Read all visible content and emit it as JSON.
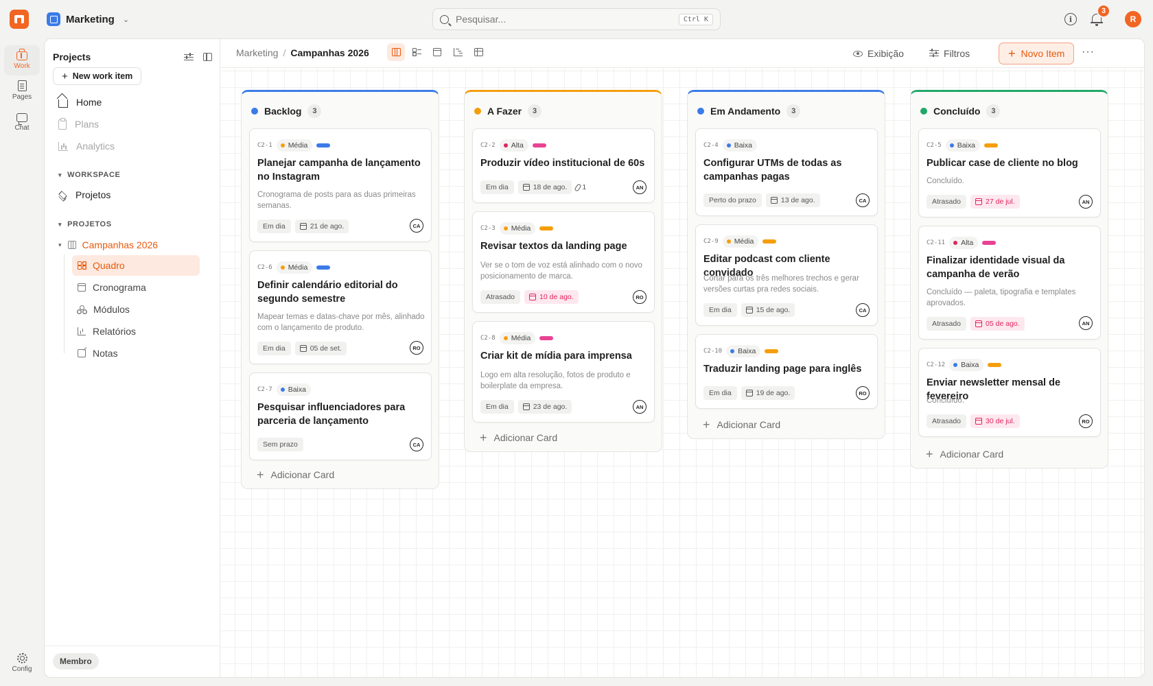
{
  "topbar": {
    "workspace_name": "Marketing",
    "search_placeholder": "Pesquisar...",
    "search_shortcut": "Ctrl K",
    "notification_count": "3",
    "user_initial": "R"
  },
  "rail": {
    "items": [
      {
        "label": "Work",
        "icon": "briefcase-icon",
        "active": true
      },
      {
        "label": "Pages",
        "icon": "page-icon"
      },
      {
        "label": "Chat",
        "icon": "chat-icon"
      }
    ],
    "config_label": "Config"
  },
  "sidebar": {
    "title": "Projects",
    "new_work_item": "New work item",
    "nav": [
      {
        "label": "Home",
        "icon": "home-icon"
      },
      {
        "label": "Plans",
        "icon": "clipboard-icon",
        "disabled": true
      },
      {
        "label": "Analytics",
        "icon": "bar-chart-icon",
        "disabled": true
      }
    ],
    "workspace_section": "WORKSPACE",
    "workspace_items": [
      {
        "label": "Projetos",
        "icon": "layers-icon"
      }
    ],
    "projects_section": "PROJETOS",
    "project_name": "Campanhas 2026",
    "project_items": [
      {
        "label": "Quadro",
        "icon": "board-icon",
        "active": true
      },
      {
        "label": "Cronograma",
        "icon": "calendar-icon"
      },
      {
        "label": "Módulos",
        "icon": "modules-icon"
      },
      {
        "label": "Relatórios",
        "icon": "reports-icon"
      },
      {
        "label": "Notas",
        "icon": "notes-icon"
      }
    ],
    "role": "Membro"
  },
  "header": {
    "breadcrumb_root": "Marketing",
    "breadcrumb_current": "Campanhas 2026",
    "views": [
      "board",
      "list",
      "calendar",
      "gantt",
      "spreadsheet"
    ],
    "display_label": "Exibição",
    "filters_label": "Filtros",
    "new_item_label": "Novo Item"
  },
  "colors": {
    "accent": "#f26522",
    "backlog": "#3b7be8",
    "todo": "#f59e0b",
    "in_progress": "#3b7be8",
    "done": "#22a86a",
    "priority_alta": "#e0245e",
    "priority_media": "#f59e0b",
    "priority_baixa": "#3b7be8"
  },
  "add_card_label": "Adicionar Card",
  "columns": [
    {
      "title": "Backlog",
      "count": "3",
      "color": "#3b7be8",
      "cards": [
        {
          "id": "C2-1",
          "priority": "Média",
          "title": "Planejar campanha de lançamento no Instagram",
          "desc": "Cronograma de posts para as duas primeiras semanas.",
          "status": "Em dia",
          "date": "21 de ago.",
          "assignee": "CA"
        },
        {
          "id": "C2-6",
          "priority": "Média",
          "title": "Definir calendário editorial do segundo semestre",
          "desc": "Mapear temas e datas-chave por mês, alinhado com o lançamento de produto.",
          "status": "Em dia",
          "date": "05 de set.",
          "assignee": "RO"
        },
        {
          "id": "C2-7",
          "priority": "Baixa",
          "title": "Pesquisar influenciadores para parceria de lançamento",
          "status": "Sem prazo",
          "assignee": "CA"
        }
      ]
    },
    {
      "title": "A Fazer",
      "count": "3",
      "color": "#f59e0b",
      "cards": [
        {
          "id": "C2-2",
          "priority": "Alta",
          "title": "Produzir vídeo institucional de 60s",
          "status": "Em dia",
          "date": "18 de ago.",
          "attachments": "1",
          "assignee": "AN"
        },
        {
          "id": "C2-3",
          "priority": "Média",
          "title": "Revisar textos da landing page",
          "desc": "Ver se o tom de voz está alinhado com o novo posicionamento de marca.",
          "status": "Atrasado",
          "date": "10 de ago.",
          "assignee": "RO"
        },
        {
          "id": "C2-8",
          "priority": "Média",
          "title": "Criar kit de mídia para imprensa",
          "desc": "Logo em alta resolução, fotos de produto e boilerplate da empresa.",
          "status": "Em dia",
          "date": "23 de ago.",
          "assignee": "AN"
        }
      ]
    },
    {
      "title": "Em Andamento",
      "count": "3",
      "color": "#3b7be8",
      "cards": [
        {
          "id": "C2-4",
          "priority": "Baixa",
          "title": "Configurar UTMs de todas as campanhas pagas",
          "status": "Perto do prazo",
          "date": "13 de ago.",
          "assignee": "CA"
        },
        {
          "id": "C2-9",
          "priority": "Média",
          "title": "Editar podcast com cliente convidado",
          "desc": "Cortar para os três melhores trechos e gerar versões curtas pra redes sociais.",
          "status": "Em dia",
          "date": "15 de ago.",
          "assignee": "CA"
        },
        {
          "id": "C2-10",
          "priority": "Baixa",
          "title": "Traduzir landing page para inglês",
          "status": "Em dia",
          "date": "19 de ago.",
          "assignee": "RO"
        }
      ]
    },
    {
      "title": "Concluído",
      "count": "3",
      "color": "#22a86a",
      "cards": [
        {
          "id": "C2-5",
          "priority": "Baixa",
          "title": "Publicar case de cliente no blog",
          "desc": "Concluído.",
          "status": "Atrasado",
          "date": "27 de jul.",
          "assignee": "AN"
        },
        {
          "id": "C2-11",
          "priority": "Alta",
          "title": "Finalizar identidade visual da campanha de verão",
          "desc": "Concluído — paleta, tipografia e templates aprovados.",
          "status": "Atrasado",
          "date": "05 de ago.",
          "assignee": "AN"
        },
        {
          "id": "C2-12",
          "priority": "Baixa",
          "title": "Enviar newsletter mensal de fevereiro",
          "desc": "Concluído.",
          "status": "Atrasado",
          "date": "30 de jul.",
          "assignee": "RO"
        }
      ]
    }
  ]
}
